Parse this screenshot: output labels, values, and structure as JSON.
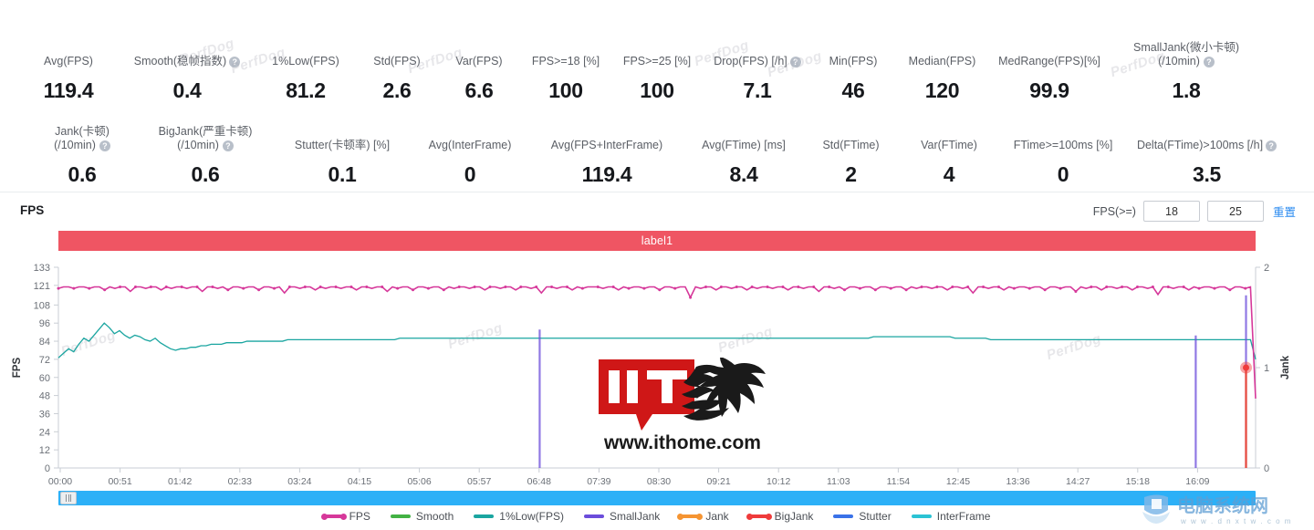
{
  "metrics_row1": [
    {
      "label": "Avg(FPS)",
      "label2": "",
      "help": false,
      "value": "119.4"
    },
    {
      "label": "Smooth(稳帧指数)",
      "label2": "",
      "help": true,
      "value": "0.4"
    },
    {
      "label": "1%Low(FPS)",
      "label2": "",
      "help": false,
      "value": "81.2"
    },
    {
      "label": "Std(FPS)",
      "label2": "",
      "help": false,
      "value": "2.6"
    },
    {
      "label": "Var(FPS)",
      "label2": "",
      "help": false,
      "value": "6.6"
    },
    {
      "label": "FPS>=18 [%]",
      "label2": "",
      "help": false,
      "value": "100"
    },
    {
      "label": "FPS>=25 [%]",
      "label2": "",
      "help": false,
      "value": "100"
    },
    {
      "label": "Drop(FPS) [/h]",
      "label2": "",
      "help": true,
      "value": "7.1"
    },
    {
      "label": "Min(FPS)",
      "label2": "",
      "help": false,
      "value": "46"
    },
    {
      "label": "Median(FPS)",
      "label2": "",
      "help": false,
      "value": "120"
    },
    {
      "label": "MedRange(FPS)[%]",
      "label2": "",
      "help": false,
      "value": "99.9"
    },
    {
      "label": "SmallJank(微小卡顿)",
      "label2": "(/10min)",
      "help": true,
      "value": "1.8"
    }
  ],
  "metrics_row2": [
    {
      "label": "Jank(卡顿)",
      "label2": "(/10min)",
      "help": true,
      "value": "0.6"
    },
    {
      "label": "BigJank(严重卡顿)",
      "label2": "(/10min)",
      "help": true,
      "value": "0.6"
    },
    {
      "label": "Stutter(卡顿率) [%]",
      "label2": "",
      "help": false,
      "value": "0.1"
    },
    {
      "label": "Avg(InterFrame)",
      "label2": "",
      "help": false,
      "value": "0"
    },
    {
      "label": "Avg(FPS+InterFrame)",
      "label2": "",
      "help": false,
      "value": "119.4"
    },
    {
      "label": "Avg(FTime) [ms]",
      "label2": "",
      "help": false,
      "value": "8.4"
    },
    {
      "label": "Std(FTime)",
      "label2": "",
      "help": false,
      "value": "2"
    },
    {
      "label": "Var(FTime)",
      "label2": "",
      "help": false,
      "value": "4"
    },
    {
      "label": "FTime>=100ms [%]",
      "label2": "",
      "help": false,
      "value": "0"
    },
    {
      "label": "Delta(FTime)>100ms [/h]",
      "label2": "",
      "help": true,
      "value": "3.5"
    }
  ],
  "chart_header": {
    "title": "FPS",
    "fps_label": "FPS(>=)",
    "threshold_low": "18",
    "threshold_high": "25",
    "reset_label": "重置"
  },
  "banner": {
    "label": "label1",
    "color": "#ef5563"
  },
  "watermark_tiles": [
    "PerfDog",
    "PerfDog",
    "PerfDog",
    "PerfDog",
    "PerfDog",
    "PerfDog",
    "PerfDog",
    "PerfDog",
    "PerfDog"
  ],
  "site_watermark": {
    "text": "www.ithome.com",
    "logo": "IT",
    "logo_cn": "之家"
  },
  "corner_watermark": {
    "text": "电脑系统网",
    "url": "w w w . d n x t w . c o m"
  },
  "legend": [
    {
      "label": "FPS",
      "color": "#d6389a",
      "style": "dotted"
    },
    {
      "label": "Smooth",
      "color": "#43b244",
      "style": "solid"
    },
    {
      "label": "1%Low(FPS)",
      "color": "#1aa5a0",
      "style": "solid"
    },
    {
      "label": "SmallJank",
      "color": "#6b4ddb",
      "style": "solid"
    },
    {
      "label": "Jank",
      "color": "#f59432",
      "style": "dotted"
    },
    {
      "label": "BigJank",
      "color": "#ef3b3b",
      "style": "dotted"
    },
    {
      "label": "Stutter",
      "color": "#3a72e8",
      "style": "solid"
    },
    {
      "label": "InterFrame",
      "color": "#2bc3d4",
      "style": "solid"
    }
  ],
  "chart_data": {
    "type": "line",
    "title": "FPS",
    "xlabel": "",
    "ylabel": "FPS",
    "y2label": "Jank",
    "ylim": [
      0,
      133
    ],
    "y2lim": [
      0,
      2
    ],
    "yticks": [
      0,
      12,
      24,
      36,
      48,
      60,
      72,
      84,
      96,
      108,
      121,
      133
    ],
    "y2ticks": [
      0,
      1,
      2
    ],
    "grid": false,
    "legend_position": "bottom",
    "xticks": [
      "00:00",
      "00:51",
      "01:42",
      "02:33",
      "03:24",
      "04:15",
      "05:06",
      "05:57",
      "06:48",
      "07:39",
      "08:30",
      "09:21",
      "10:12",
      "11:03",
      "11:54",
      "12:45",
      "13:36",
      "14:27",
      "15:18",
      "16:09"
    ],
    "annotations": [
      {
        "text": "label1",
        "type": "segment-banner",
        "color": "#ef5563",
        "x_start": "00:00",
        "x_end": "16:40"
      },
      {
        "text": "BigJank marker",
        "type": "point",
        "x": "16:32",
        "y_right": 1,
        "color": "#ef3b3b"
      }
    ],
    "series": [
      {
        "name": "FPS",
        "color": "#d6389a",
        "axis": "left",
        "values": [
          119,
          120,
          120,
          119,
          120,
          120,
          119,
          120,
          120,
          118,
          120,
          119,
          120,
          120,
          117,
          120,
          120,
          119,
          120,
          120,
          118,
          120,
          119,
          120,
          120,
          119,
          120,
          120,
          117,
          120,
          120,
          119,
          120,
          118,
          120,
          120,
          119,
          120,
          120,
          118,
          120,
          120,
          119,
          120,
          116,
          120,
          120,
          119,
          120,
          120,
          118,
          120,
          119,
          120,
          120,
          119,
          120,
          120,
          118,
          120,
          120,
          119,
          120,
          120,
          117,
          120,
          119,
          120,
          120,
          118,
          120,
          120,
          119,
          120,
          120,
          118,
          120,
          119,
          120,
          120,
          119,
          120,
          120,
          118,
          120,
          120,
          119,
          120,
          120,
          118,
          120,
          120,
          119,
          120,
          116,
          120,
          120,
          119,
          120,
          120,
          118,
          120,
          119,
          120,
          120,
          120,
          119,
          120,
          120,
          118,
          120,
          119,
          120,
          120,
          119,
          120,
          120,
          118,
          120,
          120,
          119,
          120,
          120,
          113,
          120,
          119,
          120,
          120,
          118,
          120,
          120,
          119,
          120,
          120,
          118,
          120,
          119,
          120,
          120,
          119,
          120,
          120,
          118,
          120,
          120,
          119,
          120,
          120,
          117,
          120,
          120,
          119,
          120,
          118,
          120,
          120,
          119,
          120,
          120,
          118,
          120,
          120,
          119,
          120,
          120,
          118,
          120,
          119,
          120,
          120,
          119,
          120,
          120,
          118,
          120,
          120,
          119,
          120,
          116,
          120,
          120,
          119,
          120,
          120,
          118,
          120,
          119,
          120,
          120,
          119,
          120,
          120,
          118,
          120,
          120,
          119,
          120,
          120,
          117,
          120,
          119,
          120,
          120,
          118,
          120,
          120,
          119,
          120,
          120,
          118,
          120,
          120,
          119,
          120,
          115,
          120,
          120,
          119,
          120,
          120,
          118,
          120,
          119,
          120,
          120,
          119,
          120,
          120,
          118,
          120,
          120,
          119,
          120,
          46
        ]
      },
      {
        "name": "1%Low(FPS)",
        "color": "#1aa5a0",
        "axis": "left",
        "values": [
          73,
          76,
          79,
          77,
          82,
          86,
          84,
          88,
          92,
          96,
          93,
          89,
          91,
          88,
          86,
          88,
          87,
          85,
          84,
          86,
          83,
          81,
          79,
          78,
          79,
          79,
          80,
          80,
          81,
          81,
          82,
          82,
          82,
          83,
          83,
          83,
          83,
          84,
          84,
          84,
          84,
          84,
          84,
          84,
          84,
          85,
          85,
          85,
          85,
          85,
          85,
          85,
          85,
          85,
          85,
          85,
          85,
          85,
          85,
          85,
          85,
          85,
          85,
          85,
          85,
          85,
          85,
          86,
          86,
          86,
          86,
          86,
          86,
          86,
          86,
          86,
          86,
          86,
          86,
          86,
          86,
          86,
          86,
          86,
          86,
          86,
          86,
          86,
          86,
          86,
          86,
          86,
          86,
          86,
          86,
          86,
          86,
          86,
          86,
          86,
          86,
          86,
          86,
          86,
          86,
          86,
          86,
          86,
          86,
          86,
          86,
          86,
          86,
          86,
          86,
          86,
          86,
          86,
          86,
          86,
          86,
          86,
          86,
          86,
          86,
          86,
          86,
          86,
          86,
          86,
          86,
          86,
          86,
          86,
          86,
          86,
          86,
          86,
          86,
          86,
          86,
          86,
          86,
          86,
          86,
          86,
          86,
          86,
          86,
          86,
          86,
          86,
          86,
          86,
          86,
          86,
          86,
          86,
          86,
          86,
          87,
          87,
          87,
          87,
          87,
          87,
          87,
          87,
          87,
          87,
          87,
          87,
          87,
          87,
          87,
          87,
          86,
          86,
          86,
          86,
          86,
          86,
          86,
          85,
          85,
          85,
          85,
          85,
          85,
          85,
          85,
          85,
          85,
          85,
          85,
          85,
          85,
          85,
          85,
          85,
          85,
          85,
          85,
          85,
          85,
          85,
          85,
          85,
          85,
          85,
          85,
          85,
          85,
          85,
          85,
          85,
          85,
          85,
          85,
          85,
          85,
          85,
          85,
          85,
          85,
          85,
          85,
          85,
          85,
          85,
          85,
          85,
          85,
          85,
          85,
          72
        ]
      },
      {
        "name": "SmallJank",
        "color": "#6b4ddb",
        "axis": "right",
        "spikes": [
          {
            "x": "06:42",
            "value": 1.38
          },
          {
            "x": "15:50",
            "value": 1.32
          },
          {
            "x": "16:32",
            "value": 1.72
          }
        ]
      },
      {
        "name": "Jank",
        "color": "#f59432",
        "axis": "right",
        "spikes": [
          {
            "x": "16:32",
            "value": 1.0
          }
        ]
      },
      {
        "name": "BigJank",
        "color": "#ef3b3b",
        "axis": "right",
        "spikes": [
          {
            "x": "16:32",
            "value": 1.0
          }
        ]
      },
      {
        "name": "Smooth",
        "color": "#43b244",
        "axis": "right",
        "spikes": []
      },
      {
        "name": "Stutter",
        "color": "#3a72e8",
        "axis": "right",
        "spikes": []
      },
      {
        "name": "InterFrame",
        "color": "#2bc3d4",
        "axis": "right",
        "spikes": []
      }
    ]
  }
}
